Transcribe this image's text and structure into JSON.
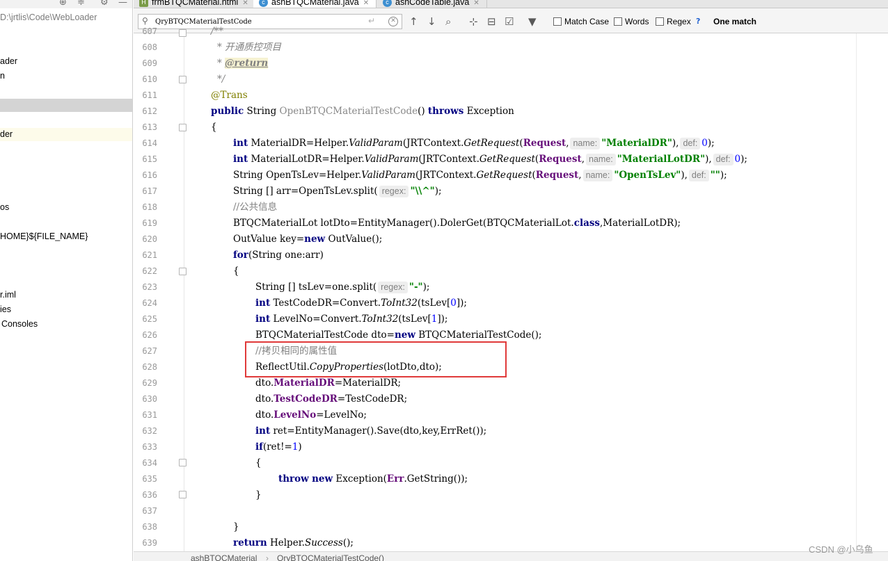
{
  "project_tree": {
    "items": [
      "D:\\jrtlis\\Code\\WebLoader",
      "ader",
      "n",
      "",
      "der",
      "os",
      "HOME}${FILE_NAME}",
      "r.iml",
      "ies",
      "Consoles"
    ]
  },
  "tabs": [
    {
      "label": "frmBTQCMaterial.html",
      "icon": "html-file-icon"
    },
    {
      "label": "ashBTQCMaterial.java",
      "icon": "java-class-icon"
    },
    {
      "label": "ashCodeTable.java",
      "icon": "java-class-icon"
    }
  ],
  "search": {
    "value": "QryBTQCMaterialTestCode",
    "match_case": "Match Case",
    "words": "Words",
    "regex": "Regex",
    "help": "?",
    "result": "One match"
  },
  "line_numbers": [
    "607",
    "608",
    "609",
    "610",
    "611",
    "612",
    "613",
    "614",
    "615",
    "616",
    "617",
    "618",
    "619",
    "620",
    "621",
    "622",
    "623",
    "624",
    "625",
    "626",
    "627",
    "628",
    "629",
    "630",
    "631",
    "632",
    "633",
    "634",
    "635",
    "636",
    "637",
    "638",
    "639"
  ],
  "code": {
    "l607": "/**",
    "l608": "* 开通质控项目",
    "l609_star": "* ",
    "l609_tag": "@return",
    "l610": "*/",
    "l611": "@Trans",
    "l612_kw": "public",
    "l612_type": " String ",
    "l612_name": "OpenBTQCMaterialTestCode",
    "l612_paren": "() ",
    "l612_throws": "throws",
    "l612_exc": " Exception",
    "l613": "{",
    "l614_kw": "int",
    "l614_a": " MaterialDR=Helper.",
    "l614_m": "ValidParam",
    "l614_b": "(JRTContext.",
    "l614_m2": "GetRequest",
    "l614_c": "(",
    "l614_f": "Request",
    "l614_d": ",",
    "l614_h1": "name:",
    "l614_s": "\"MaterialDR\"",
    "l614_e": "),",
    "l614_h2": "def:",
    "l614_n": "0",
    "l614_z": ");",
    "l615_kw": "int",
    "l615_a": " MaterialLotDR=Helper.",
    "l615_m": "ValidParam",
    "l615_b": "(JRTContext.",
    "l615_m2": "GetRequest",
    "l615_c": "(",
    "l615_f": "Request",
    "l615_d": ",",
    "l615_h1": "name:",
    "l615_s": "\"MaterialLotDR\"",
    "l615_e": "),",
    "l615_h2": "def:",
    "l615_n": "0",
    "l615_z": ");",
    "l616_a": "String OpenTsLev=Helper.",
    "l616_m": "ValidParam",
    "l616_b": "(JRTContext.",
    "l616_m2": "GetRequest",
    "l616_c": "(",
    "l616_f": "Request",
    "l616_d": ",",
    "l616_h1": "name:",
    "l616_s": "\"OpenTsLev\"",
    "l616_e": "),",
    "l616_h2": "def:",
    "l616_s2": "\"\"",
    "l616_z": ");",
    "l617_a": "String [] arr=OpenTsLev.split(",
    "l617_h": "regex:",
    "l617_s": "\"\\\\^\"",
    "l617_z": ");",
    "l618": "//公共信息",
    "l619_a": "BTQCMaterialLot lotDto=EntityManager().DolerGet(BTQCMaterialLot.",
    "l619_kw": "class",
    "l619_z": ",MaterialLotDR);",
    "l620_a": "OutValue key=",
    "l620_kw": "new",
    "l620_z": " OutValue();",
    "l621_kw": "for",
    "l621_z": "(String one:arr)",
    "l622": "{",
    "l623_a": "String [] tsLev=one.split(",
    "l623_h": "regex:",
    "l623_s": "\"-\"",
    "l623_z": ");",
    "l624_kw": "int",
    "l624_a": " TestCodeDR=Convert.",
    "l624_m": "ToInt32",
    "l624_b": "(tsLev[",
    "l624_n": "0",
    "l624_z": "]);",
    "l625_kw": "int",
    "l625_a": " LevelNo=Convert.",
    "l625_m": "ToInt32",
    "l625_b": "(tsLev[",
    "l625_n": "1",
    "l625_z": "]);",
    "l626_a": "BTQCMaterialTestCode dto=",
    "l626_kw": "new",
    "l626_z": " BTQCMaterialTestCode();",
    "l627": "//拷贝相同的属性值",
    "l628_a": "ReflectUtil.",
    "l628_m": "CopyProperties",
    "l628_z": "(lotDto,dto);",
    "l629_a": "dto.",
    "l629_f": "MaterialDR",
    "l629_z": "=MaterialDR;",
    "l630_a": "dto.",
    "l630_f": "TestCodeDR",
    "l630_z": "=TestCodeDR;",
    "l631_a": "dto.",
    "l631_f": "LevelNo",
    "l631_z": "=LevelNo;",
    "l632_kw": "int",
    "l632_z": " ret=EntityManager().Save(dto,key,ErrRet());",
    "l633_kw": "if",
    "l633_a": "(ret!=",
    "l633_n": "1",
    "l633_z": ")",
    "l634": "{",
    "l635_kw": "throw",
    "l635_kw2": "new",
    "l635_a": " Exception(",
    "l635_f": "Err",
    "l635_z": ".GetString());",
    "l636": "}",
    "l638": "}",
    "l639_kw": "return",
    "l639_a": " Helper.",
    "l639_m": "Success",
    "l639_z": "();"
  },
  "breadcrumb": [
    "ashBTQCMaterial",
    "QryBTQCMaterialTestCode()"
  ],
  "watermark": "CSDN @小乌鱼",
  "colors": {
    "keyword": "#000080",
    "string": "#008000",
    "field": "#660e7a",
    "comment": "#808080",
    "annotation": "#808000",
    "highlight_box": "#e03a3a"
  }
}
